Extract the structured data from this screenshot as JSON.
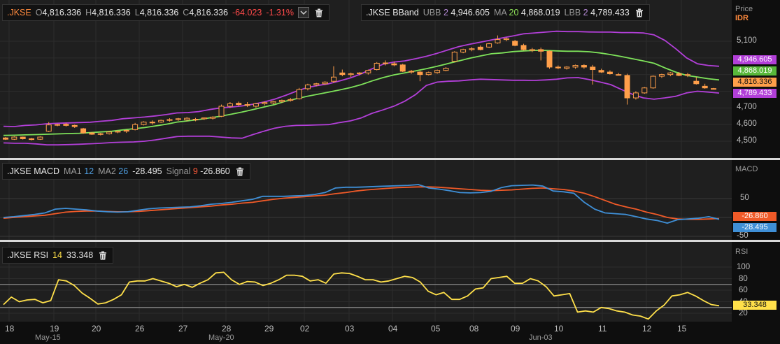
{
  "colors": {
    "candle_up": "#1f1f1f",
    "candle_down": "#ff9f4a",
    "ubb": "#b23fd8",
    "ma": "#7ee25a",
    "lbb": "#b23fd8",
    "macd": "#3f8fd6",
    "signal": "#f05a28",
    "rsi": "#ffe04a"
  },
  "price_panel": {
    "ohlc_legend": {
      "symbol": ".JKSE",
      "o_label": "O",
      "o_value": "4,816.336",
      "h_label": "H",
      "h_value": "4,816.336",
      "l_label": "L",
      "l_value": "4,816.336",
      "c_label": "C",
      "c_value": "4,816.336",
      "change": "-64.023",
      "change_pct": "-1.31%"
    },
    "bband_legend": {
      "symbol": ".JKSE BBand",
      "ubb_label": "UBB",
      "ubb_period": "2",
      "ubb_value": "4,946.605",
      "ma_label": "MA",
      "ma_period": "20",
      "ma_value": "4,868.019",
      "lbb_label": "LBB",
      "lbb_period": "2",
      "lbb_value": "4,789.433"
    },
    "axis_title": "Price",
    "axis_unit": "IDR",
    "ticks": [
      "5,100",
      "4,700",
      "4,600",
      "4,500"
    ],
    "tags": {
      "ubb": "4,946.605",
      "ma": "4,868.019",
      "close": "4,816.336",
      "lbb": "4,789.433"
    }
  },
  "macd_panel": {
    "legend": {
      "symbol": ".JKSE MACD",
      "ma1_label": "MA1",
      "ma1_value": "12",
      "ma2_label": "MA2",
      "ma2_value": "26",
      "macd_value": "-28.495",
      "signal_label": "Signal",
      "signal_period": "9",
      "signal_value": "-26.860"
    },
    "axis_title": "MACD",
    "ticks": [
      "50",
      "-50"
    ],
    "tags": {
      "signal": "-26.860",
      "macd": "-28.495"
    }
  },
  "rsi_panel": {
    "legend": {
      "symbol": ".JKSE RSI",
      "period": "14",
      "value": "33.348"
    },
    "axis_title": "RSI",
    "ticks": [
      "100",
      "80",
      "60",
      "40",
      "20"
    ],
    "tag": "33.348"
  },
  "x_axis": {
    "days": [
      "18",
      "19",
      "20",
      "26",
      "27",
      "28",
      "29",
      "02",
      "03",
      "04",
      "05",
      "08",
      "09",
      "10",
      "11",
      "12",
      "15"
    ],
    "months": [
      "May-15",
      "May-20",
      "Jun-03"
    ]
  },
  "chart_data": [
    {
      "type": "candlestick",
      "title": ".JKSE",
      "ylim": [
        4460,
        5160
      ],
      "candles": [
        [
          4520,
          4525,
          4508,
          4512
        ],
        [
          4512,
          4530,
          4508,
          4525
        ],
        [
          4525,
          4528,
          4510,
          4515
        ],
        [
          4515,
          4520,
          4505,
          4510
        ],
        [
          4512,
          4530,
          4508,
          4525
        ],
        [
          4560,
          4615,
          4555,
          4598
        ],
        [
          4598,
          4605,
          4590,
          4600
        ],
        [
          4602,
          4610,
          4588,
          4595
        ],
        [
          4595,
          4600,
          4580,
          4588
        ],
        [
          4575,
          4580,
          4545,
          4550
        ],
        [
          4550,
          4555,
          4538,
          4542
        ],
        [
          4542,
          4550,
          4535,
          4545
        ],
        [
          4545,
          4560,
          4540,
          4555
        ],
        [
          4555,
          4565,
          4548,
          4560
        ],
        [
          4560,
          4570,
          4550,
          4565
        ],
        [
          4570,
          4610,
          4565,
          4600
        ],
        [
          4600,
          4620,
          4595,
          4615
        ],
        [
          4615,
          4625,
          4600,
          4610
        ],
        [
          4615,
          4630,
          4610,
          4625
        ],
        [
          4625,
          4638,
          4618,
          4630
        ],
        [
          4630,
          4640,
          4622,
          4635
        ],
        [
          4628,
          4645,
          4620,
          4638
        ],
        [
          4632,
          4640,
          4620,
          4630
        ],
        [
          4635,
          4642,
          4628,
          4640
        ],
        [
          4638,
          4650,
          4630,
          4645
        ],
        [
          4650,
          4720,
          4645,
          4710
        ],
        [
          4710,
          4735,
          4700,
          4725
        ],
        [
          4728,
          4738,
          4712,
          4720
        ],
        [
          4720,
          4735,
          4705,
          4715
        ],
        [
          4710,
          4730,
          4700,
          4725
        ],
        [
          4725,
          4738,
          4715,
          4732
        ],
        [
          4730,
          4742,
          4722,
          4738
        ],
        [
          4738,
          4750,
          4730,
          4745
        ],
        [
          4745,
          4760,
          4738,
          4750
        ],
        [
          4755,
          4820,
          4750,
          4810
        ],
        [
          4815,
          4845,
          4805,
          4838
        ],
        [
          4838,
          4850,
          4830,
          4845
        ],
        [
          4845,
          4860,
          4838,
          4855
        ],
        [
          4860,
          4950,
          4850,
          4885
        ],
        [
          4910,
          4930,
          4890,
          4900
        ],
        [
          4900,
          4912,
          4885,
          4905
        ],
        [
          4905,
          4915,
          4895,
          4910
        ],
        [
          4910,
          4930,
          4900,
          4925
        ],
        [
          4930,
          4975,
          4925,
          4968
        ],
        [
          4968,
          4985,
          4955,
          4970
        ],
        [
          4965,
          4978,
          4950,
          4958
        ],
        [
          4958,
          4965,
          4915,
          4920
        ],
        [
          4920,
          4928,
          4905,
          4915
        ],
        [
          4915,
          4922,
          4860,
          4900
        ],
        [
          4900,
          4918,
          4895,
          4912
        ],
        [
          4912,
          4930,
          4905,
          4925
        ],
        [
          4925,
          4945,
          4920,
          4938
        ],
        [
          4980,
          5040,
          4975,
          5035
        ],
        [
          5035,
          5055,
          5028,
          5050
        ],
        [
          5050,
          5065,
          5040,
          5055
        ],
        [
          5065,
          5075,
          5045,
          5050
        ],
        [
          5065,
          5090,
          5060,
          5085
        ],
        [
          5090,
          5135,
          5085,
          5110
        ],
        [
          5110,
          5122,
          5100,
          5115
        ],
        [
          5100,
          5108,
          5070,
          5075
        ],
        [
          5075,
          5085,
          5045,
          5050
        ],
        [
          5045,
          5060,
          5035,
          5050
        ],
        [
          5050,
          5062,
          4985,
          5040
        ],
        [
          5040,
          5045,
          4935,
          4945
        ],
        [
          4945,
          4955,
          4932,
          4940
        ],
        [
          4938,
          4950,
          4930,
          4945
        ],
        [
          4945,
          4960,
          4935,
          4955
        ],
        [
          4955,
          4962,
          4935,
          4945
        ],
        [
          4945,
          4958,
          4840,
          4930
        ],
        [
          4925,
          4935,
          4910,
          4915
        ],
        [
          4915,
          4925,
          4900,
          4905
        ],
        [
          4900,
          4910,
          4895,
          4898
        ],
        [
          4895,
          4905,
          4720,
          4760
        ],
        [
          4760,
          4800,
          4750,
          4790
        ],
        [
          4790,
          4825,
          4785,
          4820
        ],
        [
          4820,
          4895,
          4815,
          4890
        ],
        [
          4890,
          4905,
          4880,
          4900
        ],
        [
          4900,
          4915,
          4890,
          4910
        ],
        [
          4905,
          4915,
          4890,
          4895
        ],
        [
          4895,
          4910,
          4885,
          4900
        ],
        [
          4860,
          4885,
          4840,
          4845
        ],
        [
          4830,
          4845,
          4815,
          4820
        ],
        [
          4816,
          4820,
          4810,
          4816
        ]
      ]
    },
    {
      "type": "line",
      "title": ".JKSE BBand",
      "series": [
        {
          "name": "UBB",
          "values": [
            4590,
            4588,
            4595,
            4598,
            4605,
            4608,
            4610,
            4612,
            4614,
            4620,
            4625,
            4635,
            4640,
            4645,
            4652,
            4660,
            4670,
            4672,
            4678,
            4690,
            4700,
            4705,
            4712,
            4722,
            4735,
            4752,
            4775,
            4800,
            4822,
            4835,
            4845,
            4862,
            4880,
            4905,
            4935,
            4962,
            4975,
            4982,
            4995,
            5010,
            5028,
            5048,
            5068,
            5082,
            5095,
            5108,
            5120,
            5132,
            5145,
            5150,
            5155,
            5160,
            5158,
            5158,
            5156,
            5155,
            5155,
            5152,
            5152,
            5150,
            5138,
            5105,
            5055,
            5000,
            4965,
            4955,
            4950
          ]
        },
        {
          "name": "MA",
          "values": [
            4535,
            4536,
            4538,
            4540,
            4542,
            4544,
            4546,
            4548,
            4552,
            4556,
            4560,
            4568,
            4575,
            4582,
            4592,
            4602,
            4615,
            4622,
            4630,
            4640,
            4650,
            4662,
            4675,
            4690,
            4705,
            4720,
            4740,
            4755,
            4770,
            4782,
            4795,
            4808,
            4822,
            4840,
            4862,
            4882,
            4898,
            4910,
            4922,
            4935,
            4950,
            4966,
            4982,
            4998,
            5012,
            5025,
            5030,
            5038,
            5042,
            5045,
            5045,
            5042,
            5040,
            5040,
            5037,
            5030,
            5020,
            5008,
            4995,
            4982,
            4968,
            4940,
            4915,
            4895,
            4885,
            4875,
            4868
          ]
        },
        {
          "name": "LBB",
          "values": [
            4490,
            4488,
            4488,
            4484,
            4478,
            4478,
            4480,
            4482,
            4485,
            4488,
            4492,
            4494,
            4496,
            4500,
            4508,
            4518,
            4528,
            4530,
            4530,
            4530,
            4525,
            4520,
            4518,
            4540,
            4560,
            4578,
            4590,
            4595,
            4596,
            4598,
            4600,
            4612,
            4622,
            4640,
            4668,
            4688,
            4710,
            4740,
            4780,
            4835,
            4855,
            4860,
            4862,
            4868,
            4872,
            4870,
            4868,
            4866,
            4866,
            4865,
            4868,
            4872,
            4880,
            4882,
            4870,
            4856,
            4840,
            4810,
            4782,
            4760,
            4752,
            4760,
            4770,
            4790,
            4800,
            4795,
            4789
          ]
        }
      ]
    },
    {
      "type": "line",
      "title": ".JKSE MACD",
      "ylim": [
        -65,
        105
      ],
      "series": [
        {
          "name": "MACD",
          "values": [
            0,
            2,
            5,
            8,
            12,
            22,
            24,
            22,
            20,
            17,
            15,
            14,
            15,
            19,
            23,
            25,
            26,
            27,
            28,
            31,
            35,
            37,
            40,
            44,
            48,
            56,
            56,
            56,
            57,
            58,
            61,
            66,
            78,
            80,
            80,
            81,
            82,
            83,
            84,
            85,
            87,
            78,
            75,
            71,
            66,
            65,
            66,
            69,
            79,
            84,
            85,
            86,
            83,
            70,
            68,
            64,
            40,
            22,
            12,
            10,
            8,
            2,
            -4,
            -8,
            -15,
            -6,
            -4,
            -2,
            2,
            -5
          ]
        },
        {
          "name": "Signal",
          "values": [
            -2,
            0,
            2,
            4,
            6,
            10,
            14,
            16,
            17,
            17,
            16,
            15,
            15,
            16,
            18,
            20,
            22,
            24,
            26,
            28,
            30,
            33,
            35,
            38,
            40,
            44,
            48,
            51,
            53,
            55,
            57,
            59,
            63,
            66,
            70,
            73,
            75,
            77,
            79,
            80,
            81,
            81,
            80,
            78,
            76,
            74,
            72,
            71,
            72,
            73,
            75,
            77,
            78,
            76,
            74,
            70,
            64,
            55,
            45,
            35,
            28,
            22,
            14,
            8,
            0,
            -4,
            -5,
            -5,
            -4,
            -3
          ]
        }
      ]
    },
    {
      "type": "line",
      "title": ".JKSE RSI",
      "ylim": [
        7,
        105
      ],
      "series": [
        {
          "name": "RSI",
          "values": [
            35,
            48,
            40,
            43,
            44,
            38,
            42,
            78,
            76,
            68,
            55,
            46,
            36,
            38,
            44,
            52,
            74,
            76,
            76,
            80,
            76,
            72,
            66,
            70,
            65,
            72,
            78,
            90,
            91,
            78,
            70,
            75,
            74,
            68,
            72,
            78,
            86,
            86,
            84,
            76,
            78,
            72,
            88,
            90,
            89,
            84,
            78,
            78,
            74,
            76,
            80,
            84,
            82,
            74,
            58,
            52,
            56,
            44,
            44,
            50,
            62,
            64,
            80,
            82,
            84,
            72,
            72,
            80,
            76,
            66,
            50,
            52,
            54,
            22,
            24,
            22,
            30,
            28,
            24,
            22,
            17,
            15,
            10,
            24,
            34,
            50,
            52,
            56,
            50,
            42,
            35,
            33
          ]
        }
      ]
    }
  ]
}
